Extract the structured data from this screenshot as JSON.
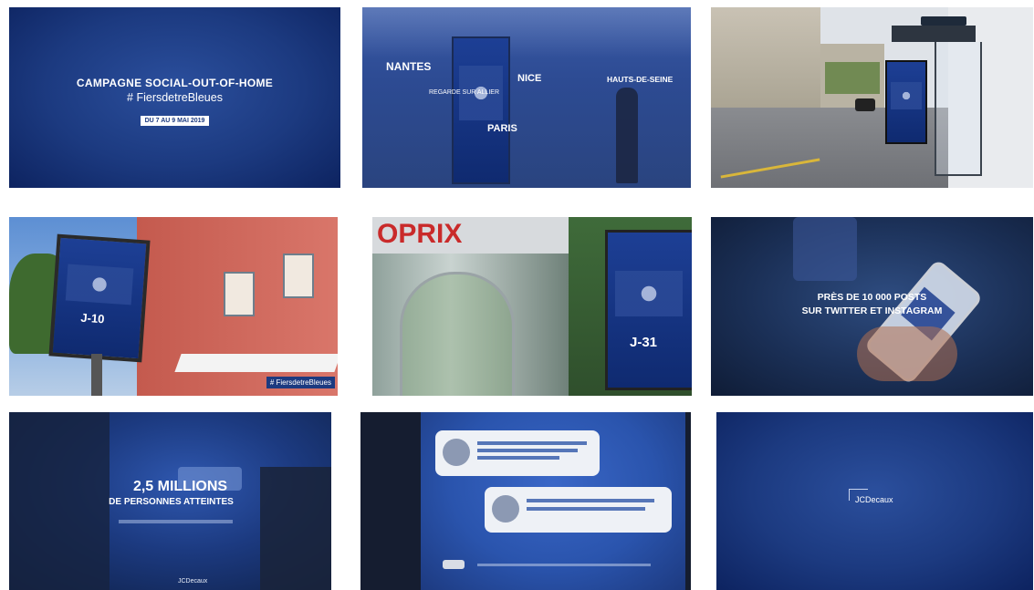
{
  "tile1": {
    "title": "CAMPAGNE SOCIAL-OUT-OF-HOME",
    "hashtag": "# FiersdetreBleues",
    "dates": "DU 7 AU 9 MAI 2019"
  },
  "tile2": {
    "cities": {
      "nantes": "NANTES",
      "nice": "NICE",
      "hauts": "HAUTS-DE-SEINE",
      "paris": "PARIS",
      "region": "REGARDE SUR ALLIER"
    }
  },
  "tile4": {
    "hashtag": "# FiersdetreBleues",
    "countdown": "J-10"
  },
  "tile5": {
    "store_sign": "OPRIX",
    "countdown": "J-31"
  },
  "tile6": {
    "line1": "PRÈS DE 10 000 POSTS",
    "line2": "SUR TWITTER ET INSTAGRAM"
  },
  "tile7": {
    "big": "2,5 MILLIONS",
    "sub": "DE PERSONNES ATTEINTES",
    "brand": "JCDecaux"
  },
  "tile9": {
    "logo": "JCDecaux"
  },
  "colors": {
    "navy": "#1c3a80",
    "deep": "#0d2360",
    "white": "#ffffff"
  }
}
